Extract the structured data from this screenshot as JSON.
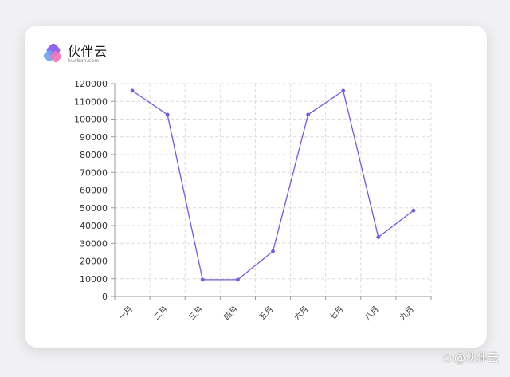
{
  "brand": {
    "name": "伙伴云",
    "domain": "huoban.com",
    "colors": [
      "#8b5cf6",
      "#f472b6",
      "#60a5fa"
    ]
  },
  "watermark": {
    "icon": "chat-bubble-icon",
    "text": "@伙伴云"
  },
  "chart_data": {
    "type": "line",
    "title": "",
    "xlabel": "",
    "ylabel": "",
    "categories": [
      "一月",
      "二月",
      "三月",
      "四月",
      "五月",
      "六月",
      "七月",
      "八月",
      "九月"
    ],
    "values": [
      116000,
      102500,
      9500,
      9500,
      25500,
      102500,
      116000,
      33500,
      48500
    ],
    "ylim": [
      0,
      120000
    ],
    "yticks": [
      "0",
      "10000",
      "20000",
      "30000",
      "40000",
      "50000",
      "60000",
      "70000",
      "80000",
      "90000",
      "100000",
      "110000",
      "120000"
    ],
    "grid": true,
    "line_color": "#6d5bf1"
  }
}
